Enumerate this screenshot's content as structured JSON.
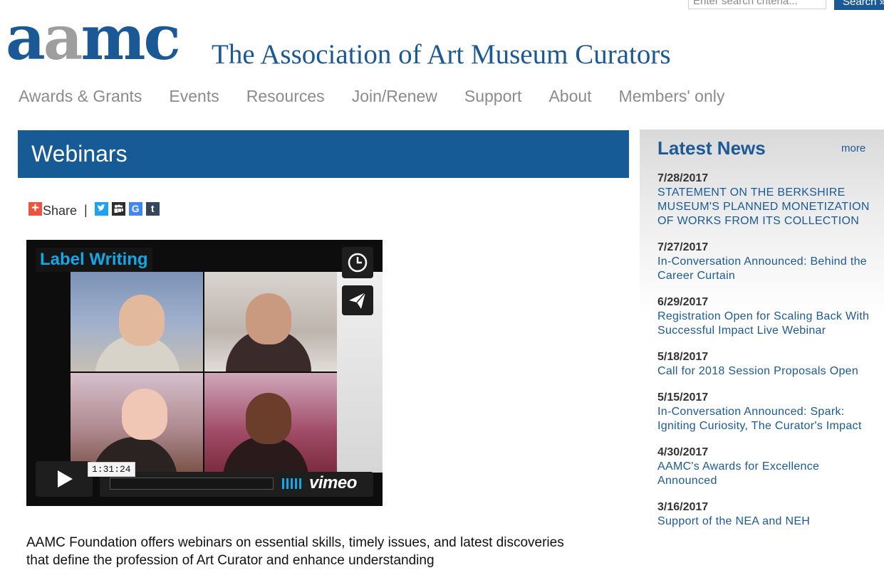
{
  "search": {
    "placeholder": "Enter search criteria...",
    "button_label": "Search »"
  },
  "logo": {
    "mark_part1": "a",
    "mark_part2": "a",
    "mark_part3": "mc",
    "title": "The Association of Art Museum Curators"
  },
  "nav": [
    "Awards & Grants",
    "Events",
    "Resources",
    "Join/Renew",
    "Support",
    "About",
    "Members' only"
  ],
  "page": {
    "title": "Webinars"
  },
  "share": {
    "label": "Share",
    "separator": "|"
  },
  "video": {
    "title": "Label Writing",
    "duration": "1:31:24",
    "provider": "vimeo"
  },
  "intro": "AAMC Foundation offers webinars on essential skills, timely issues, and latest discoveries that define the profession of Art Curator and enhance understanding",
  "news": {
    "heading": "Latest News",
    "more_label": "more",
    "items": [
      {
        "date": "7/28/2017",
        "title": "STATEMENT ON THE BERKSHIRE MUSEUM'S PLANNED MONETIZATION OF WORKS FROM ITS COLLECTION"
      },
      {
        "date": "7/27/2017",
        "title": "In-Conversation Announced: Behind the Career Curtain"
      },
      {
        "date": "6/29/2017",
        "title": "Registration Open for Scaling Back With Successful Impact Live Webinar"
      },
      {
        "date": "5/18/2017",
        "title": "Call for 2018 Session Proposals Open"
      },
      {
        "date": "5/15/2017",
        "title": "In-Conversation Announced: Spark: Igniting Curiosity, The Curator's Impact"
      },
      {
        "date": "4/30/2017",
        "title": "AAMC's Awards for Excellence Announced"
      },
      {
        "date": "3/16/2017",
        "title": "Support of the NEA and NEH"
      }
    ]
  },
  "colors": {
    "brand_blue": "#165a96",
    "nav_gray": "#8b8b8b",
    "logo_gray": "#9e9e9e",
    "vimeo_blue": "#11a8e8"
  }
}
